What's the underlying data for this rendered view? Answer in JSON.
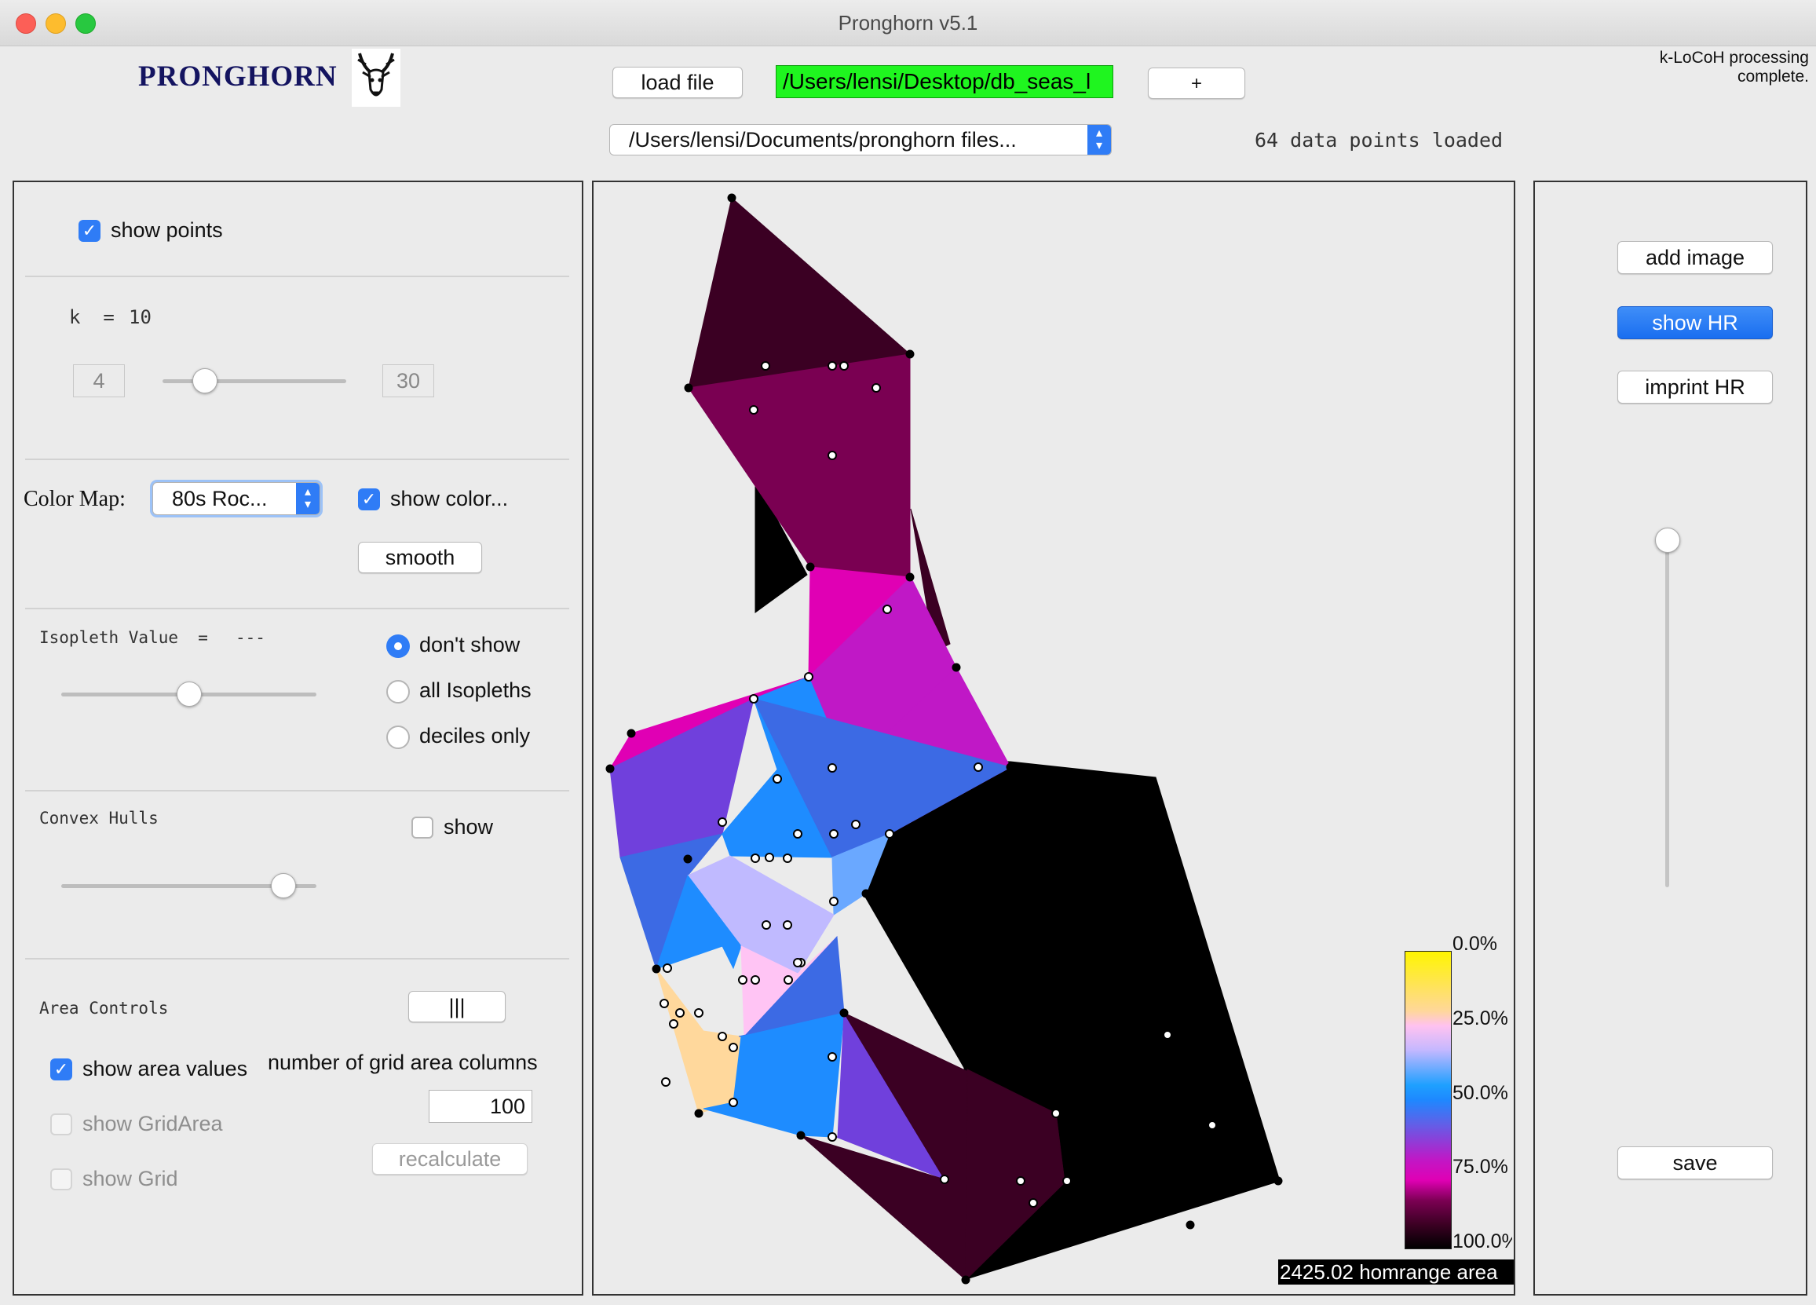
{
  "window": {
    "title": "Pronghorn v5.1"
  },
  "header": {
    "logo_text": "PRONGHORN",
    "load_button": "load file",
    "file_path": "/Users/lensi/Desktop/db_seas_l",
    "plus_button": "+",
    "directory_select": "/Users/lensi/Documents/pronghorn files...",
    "status": "k-LoCoH processing complete.",
    "points_loaded": "64 data points loaded"
  },
  "left_panel": {
    "show_points": {
      "label": "show points",
      "checked": true
    },
    "k": {
      "label": "k  =",
      "value": "10",
      "min": "4",
      "max": "30",
      "slider_fraction": 0.23
    },
    "color_map": {
      "label": "Color Map:",
      "selected": "80s Roc...",
      "show_color_label": "show color...",
      "show_color_checked": true,
      "smooth_button": "smooth"
    },
    "isopleth": {
      "label": "Isopleth Value  =",
      "value": "---",
      "slider_fraction": 0.5,
      "options": [
        {
          "label": "don't show",
          "selected": true
        },
        {
          "label": "all Isopleths",
          "selected": false
        },
        {
          "label": "deciles only",
          "selected": false
        }
      ]
    },
    "convex_hulls": {
      "label": "Convex Hulls",
      "show_label": "show",
      "checked": false,
      "slider_fraction": 0.87
    },
    "area": {
      "label": "Area Controls",
      "handle_button": "|||",
      "show_area_values": "show area values",
      "show_area_values_checked": true,
      "grid_columns_label": "number of grid area columns",
      "grid_columns_value": "100",
      "show_grid_area": "show GridArea",
      "show_grid": "show Grid",
      "recalculate": "recalculate"
    }
  },
  "right_panel": {
    "add_image": "add image",
    "show_hr": "show HR",
    "imprint_hr": "imprint HR",
    "save": "save",
    "slider_fraction": 0.0
  },
  "map": {
    "legend_labels": [
      "0.0%",
      "25.0%",
      "50.0%",
      "75.0%",
      "100.0%"
    ],
    "area_text": "2425.02 homrange area",
    "colors": {
      "c1": "#3b0023",
      "c2": "#7a0052",
      "c3": "#e000b4",
      "c4": "#c018c6",
      "c5": "#7040dc",
      "c6": "#3c6ae4",
      "c7": "#1e8cff",
      "c8": "#6aa8ff",
      "c9": "#c0baff",
      "c10": "#ffc4f4",
      "c11": "#ffd89c",
      "c12": "#000000"
    }
  }
}
